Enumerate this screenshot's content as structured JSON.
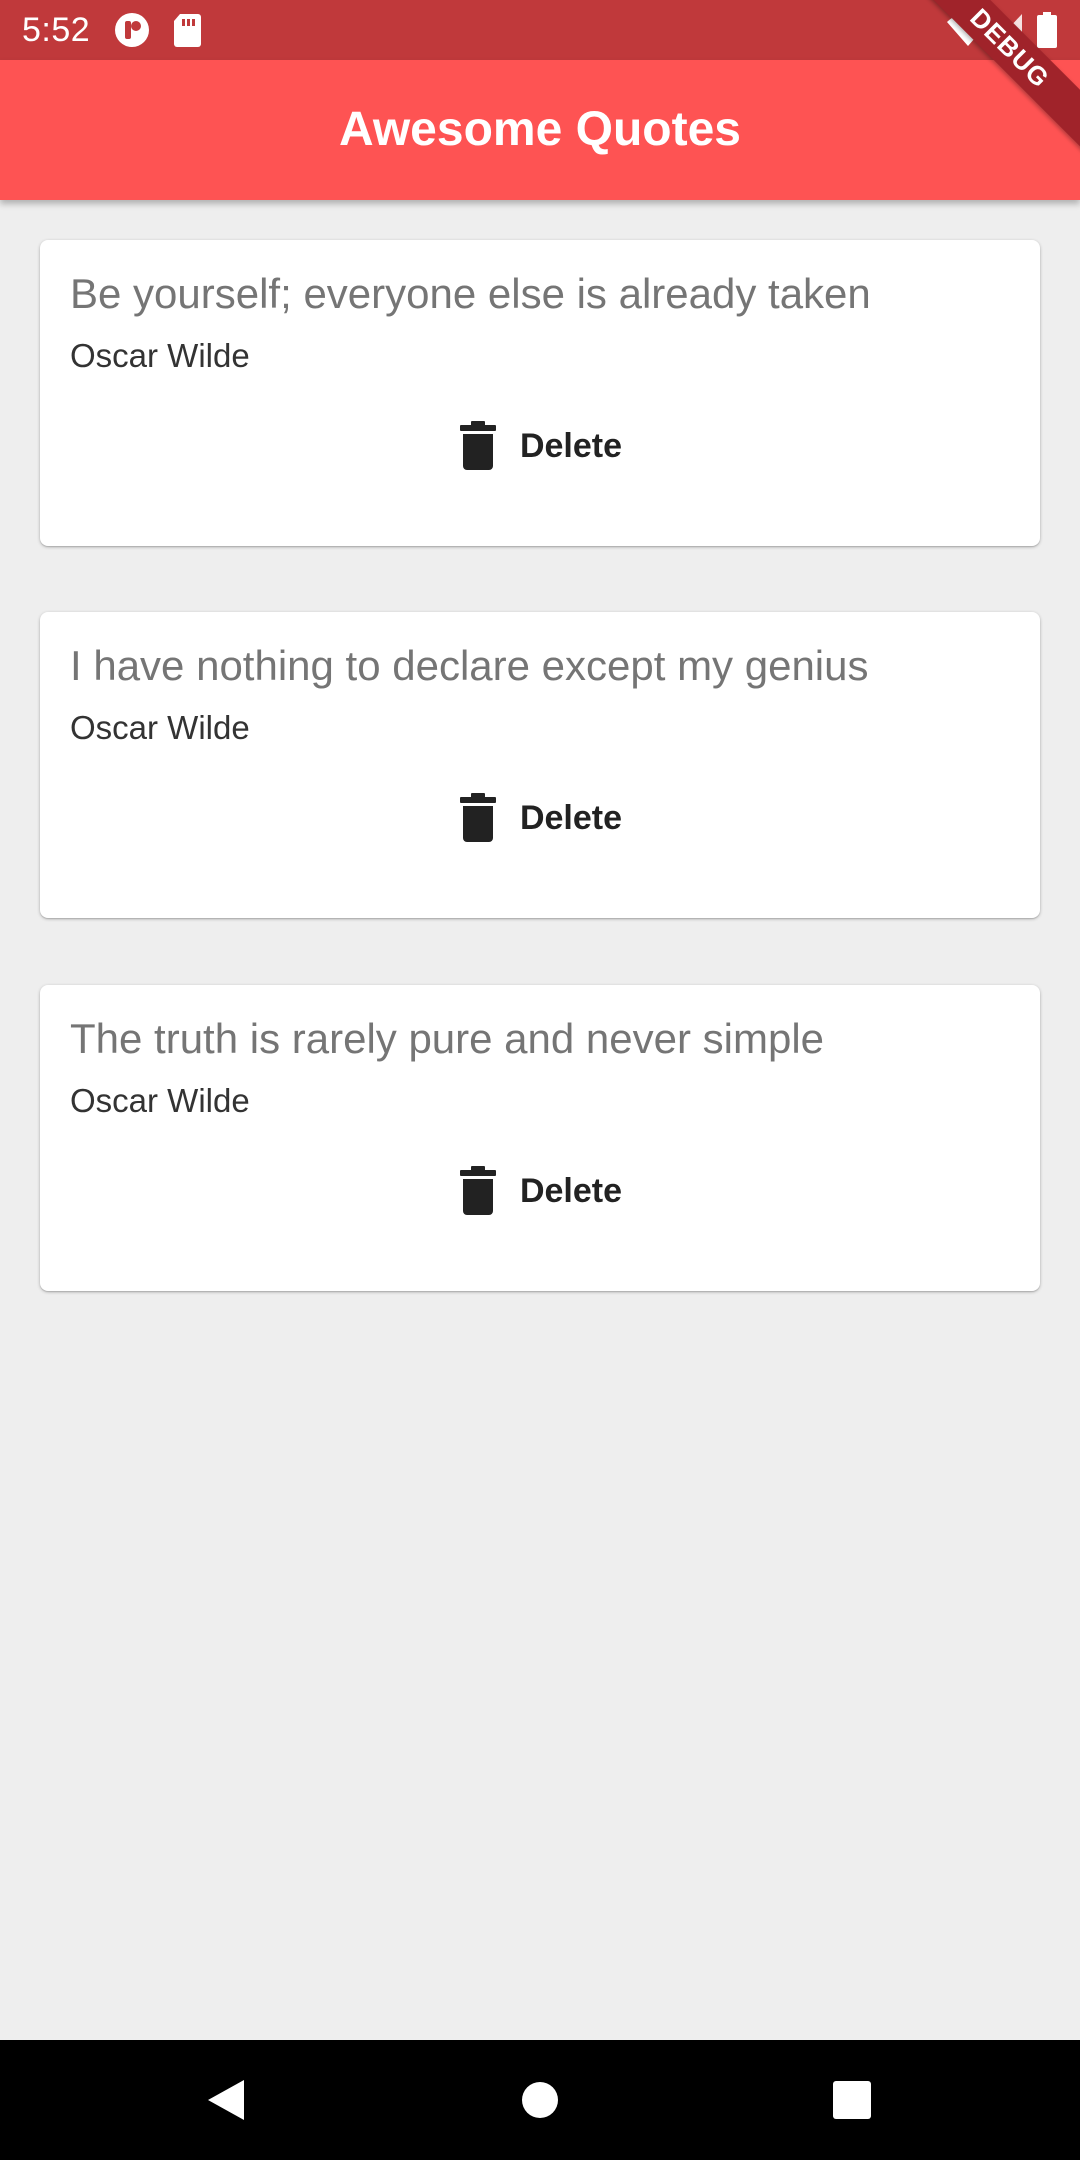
{
  "status_bar": {
    "time": "5:52",
    "icons": [
      "app-notification-icon",
      "sd-card-icon",
      "wifi-icon",
      "signal-icon",
      "battery-icon"
    ]
  },
  "app_bar": {
    "title": "Awesome Quotes",
    "color": "#fe5353"
  },
  "debug_banner": {
    "label": "DEBUG"
  },
  "quotes": [
    {
      "text": "Be yourself; everyone else is already taken",
      "author": "Oscar Wilde",
      "delete_label": "Delete"
    },
    {
      "text": "I have nothing to declare except my genius",
      "author": "Oscar Wilde",
      "delete_label": "Delete"
    },
    {
      "text": "The truth is rarely pure and never simple",
      "author": "Oscar Wilde",
      "delete_label": "Delete"
    }
  ],
  "nav_bar": {
    "buttons": [
      "back-icon",
      "home-icon",
      "recents-icon"
    ]
  }
}
